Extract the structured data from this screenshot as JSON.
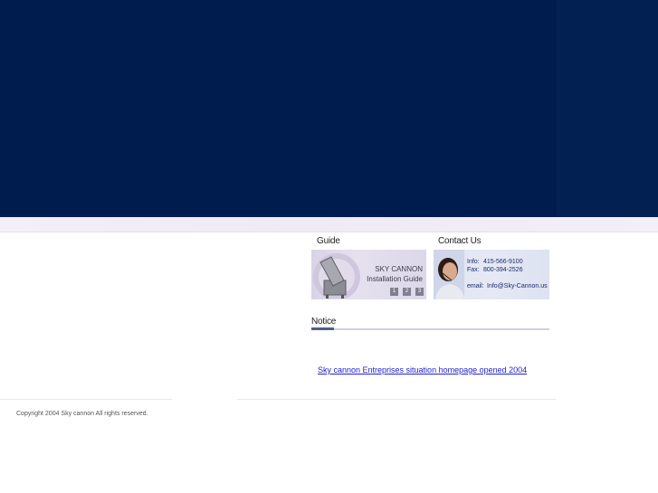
{
  "guide": {
    "title": "Guide",
    "card_line1": "SKY CANNON",
    "card_line2": "Installation Guide",
    "pages": [
      "1",
      "2",
      "3"
    ]
  },
  "contact": {
    "title": "Contact Us",
    "info_label": "Info:",
    "info_value": "415-566-9100",
    "fax_label": "Fax:",
    "fax_value": "800-394-2526",
    "email_label": "email:",
    "email_value": "Info@Sky-Cannon.us"
  },
  "notice": {
    "title": "Notice",
    "items": [
      {
        "text": "Sky cannon Entreprises situation homepage opened   2004"
      }
    ]
  },
  "footer": {
    "copyright": "Copyright 2004 Sky cannon All rights reserved."
  },
  "colors": {
    "hero": "#001c4f",
    "link": "#2222cc"
  }
}
